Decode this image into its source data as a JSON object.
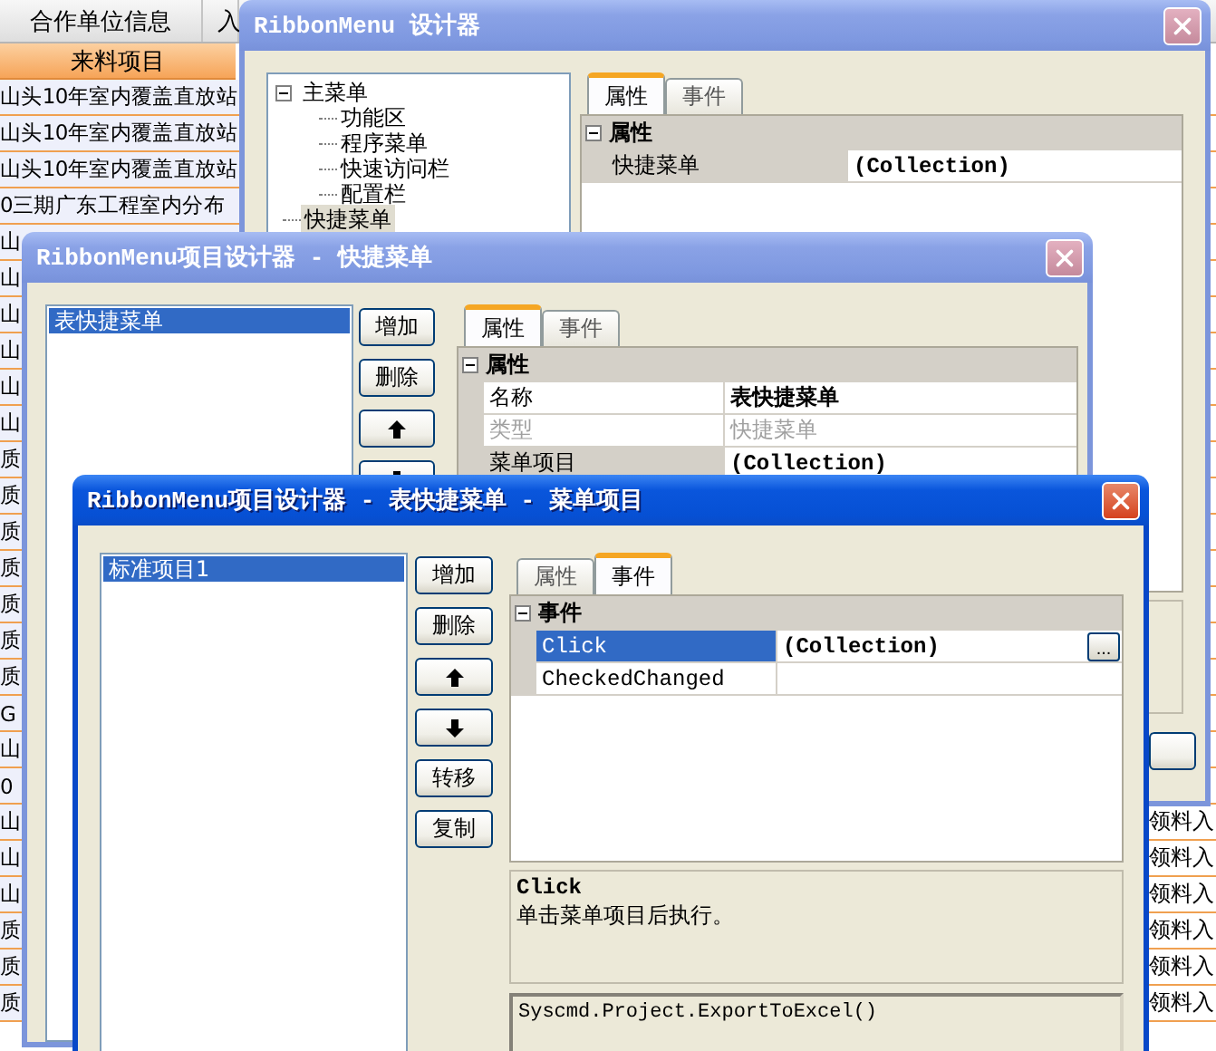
{
  "background_sheet": {
    "columns": [
      {
        "label": "合作单位信息"
      },
      {
        "label": "入"
      }
    ],
    "group_header": "来料项目",
    "rows": [
      {
        "item": "山头10年室内覆盖直放站"
      },
      {
        "item": "山头10年室内覆盖直放站"
      },
      {
        "item": "山头10年室内覆盖直放站"
      },
      {
        "item": "0三期广东工程室内分布"
      },
      {
        "item": "山"
      },
      {
        "item": "山"
      },
      {
        "item": "山"
      },
      {
        "item": "山"
      },
      {
        "item": "山"
      },
      {
        "item": "山"
      },
      {
        "item": "质"
      },
      {
        "item": "质"
      },
      {
        "item": "质"
      },
      {
        "item": "质"
      },
      {
        "item": "质"
      },
      {
        "item": "质"
      },
      {
        "item": "质"
      },
      {
        "item": "G"
      },
      {
        "item": "山"
      },
      {
        "item": "0"
      },
      {
        "item": "山",
        "right_column": "领料入"
      },
      {
        "item": "山",
        "right_column": "领料入"
      },
      {
        "item": "山",
        "right_column": "领料入"
      },
      {
        "item": "质",
        "right_column": "领料入"
      },
      {
        "item": "质",
        "right_column": "领料入"
      },
      {
        "item": "质",
        "right_column": "领料入"
      }
    ]
  },
  "windows": [
    {
      "title": "RibbonMenu 设计器",
      "active": false,
      "tree": [
        {
          "label": "主菜单",
          "expanded": true,
          "selected": false,
          "children": [
            {
              "label": "功能区",
              "selected": false
            },
            {
              "label": "程序菜单",
              "selected": false
            },
            {
              "label": "快速访问栏",
              "selected": false
            },
            {
              "label": "配置栏",
              "selected": false
            }
          ]
        },
        {
          "label": "快捷菜单",
          "selected": true
        }
      ],
      "tabs": [
        {
          "label": "属性",
          "selected": true
        },
        {
          "label": "事件",
          "selected": false
        }
      ],
      "grid": {
        "category": "属性",
        "expanded": true,
        "rows": [
          {
            "name": "快捷菜单",
            "value": "(Collection)",
            "selected": true,
            "disabled": false
          }
        ]
      }
    },
    {
      "title": "RibbonMenu项目设计器 - 快捷菜单",
      "active": false,
      "list": [
        {
          "label": "表快捷菜单",
          "selected": true
        }
      ],
      "side_buttons": [
        {
          "kind": "text",
          "label": "增加"
        },
        {
          "kind": "text",
          "label": "删除"
        },
        {
          "kind": "up"
        },
        {
          "kind": "down"
        }
      ],
      "tabs": [
        {
          "label": "属性",
          "selected": true
        },
        {
          "label": "事件",
          "selected": false
        }
      ],
      "grid": {
        "category": "属性",
        "expanded": true,
        "rows": [
          {
            "name": "名称",
            "value": "表快捷菜单",
            "selected": false,
            "disabled": false
          },
          {
            "name": "类型",
            "value": "快捷菜单",
            "selected": false,
            "disabled": true
          },
          {
            "name": "菜单项目",
            "value": "(Collection)",
            "selected": true,
            "disabled": false
          }
        ]
      }
    },
    {
      "title": "RibbonMenu项目设计器 - 表快捷菜单 - 菜单项目",
      "active": true,
      "list": [
        {
          "label": "标准项目1",
          "selected": true
        }
      ],
      "side_buttons": [
        {
          "kind": "text",
          "label": "增加"
        },
        {
          "kind": "text",
          "label": "删除"
        },
        {
          "kind": "up"
        },
        {
          "kind": "down"
        },
        {
          "kind": "text",
          "label": "转移"
        },
        {
          "kind": "text",
          "label": "复制"
        }
      ],
      "tabs": [
        {
          "label": "属性",
          "selected": false
        },
        {
          "label": "事件",
          "selected": true
        }
      ],
      "grid": {
        "category": "事件",
        "expanded": true,
        "rows": [
          {
            "name": "Click",
            "value": "(Collection)",
            "selected": true,
            "disabled": false,
            "action": "..."
          },
          {
            "name": "CheckedChanged",
            "selected": false,
            "disabled": false
          }
        ]
      },
      "description": {
        "title": "Click",
        "text": "单击菜单项目后执行。"
      },
      "code": "Syscmd.Project.ExportToExcel()"
    }
  ]
}
